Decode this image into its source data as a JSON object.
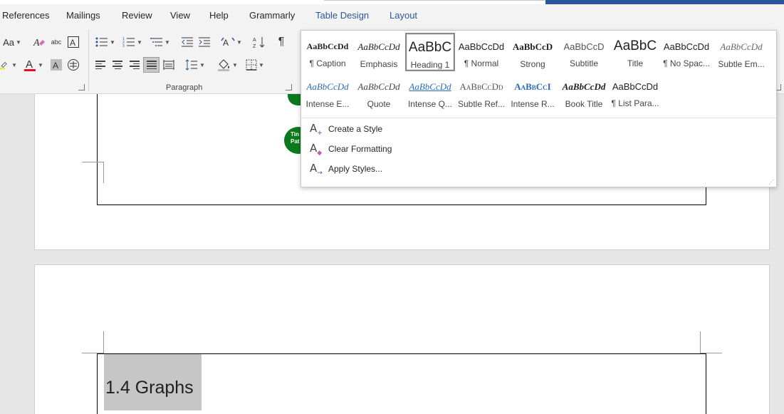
{
  "tabs": [
    "References",
    "Mailings",
    "Review",
    "View",
    "Help",
    "Grammarly",
    "Table Design",
    "Layout"
  ],
  "ribbon": {
    "font_group": {
      "change_case": "Aa",
      "highlight_color": "#f5e13a",
      "font_color": "#e81123"
    },
    "paragraph_label": "Paragraph",
    "pilcrow": "¶"
  },
  "gallery": {
    "styles": [
      {
        "preview": "AaBbCcDd",
        "label": "¶ Caption"
      },
      {
        "preview": "AaBbCcDd",
        "label": "Emphasis"
      },
      {
        "preview": "AaBbC",
        "label": "Heading 1"
      },
      {
        "preview": "AaBbCcDd",
        "label": "¶ Normal"
      },
      {
        "preview": "AaBbCcD",
        "label": "Strong"
      },
      {
        "preview": "AaBbCcD",
        "label": "Subtitle"
      },
      {
        "preview": "AaBbC",
        "label": "Title"
      },
      {
        "preview": "AaBbCcDd",
        "label": "¶ No Spac..."
      },
      {
        "preview": "AaBbCcDd",
        "label": "Subtle Em..."
      },
      {
        "preview": "AaBbCcDd",
        "label": "Intense E..."
      },
      {
        "preview": "AaBbCcDd",
        "label": "Quote"
      },
      {
        "preview": "AaBbCcDd",
        "label": "Intense Q..."
      },
      {
        "preview": "AaBbCcDd",
        "label": "Subtle Ref..."
      },
      {
        "preview": "AaBbCcI",
        "label": "Intense R..."
      },
      {
        "preview": "AaBbCcDd",
        "label": "Book Title"
      },
      {
        "preview": "AaBbCcDd",
        "label": "¶ List Para..."
      }
    ],
    "selected_index": 2,
    "menu": [
      "Create a Style",
      "Clear Formatting",
      "Apply Styles..."
    ]
  },
  "document": {
    "shape_text": "Tin\nPat",
    "heading": "1.4 Graphs"
  },
  "colors": {
    "accent": "#2b579a",
    "shape_green": "#0b7a1f"
  }
}
